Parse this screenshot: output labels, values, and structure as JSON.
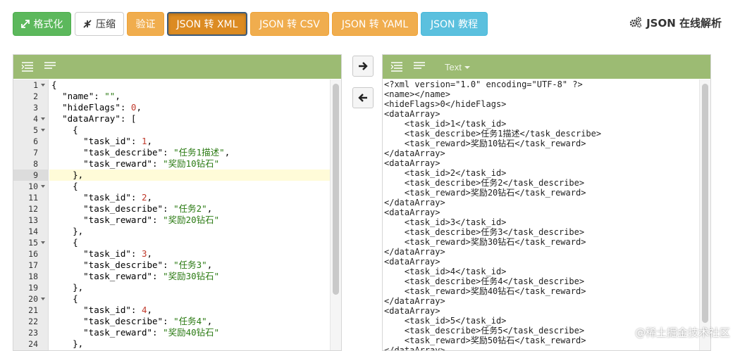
{
  "toolbar": {
    "format_label": "格式化",
    "compress_label": "压缩",
    "validate_label": "验证",
    "to_xml_label": "JSON 转 XML",
    "to_csv_label": "JSON 转 CSV",
    "to_yaml_label": "JSON 转 YAML",
    "tutorial_label": "JSON 教程",
    "brand_label": "JSON 在线解析"
  },
  "colors": {
    "green": "#5cb85c",
    "orange": "#f0ad4e",
    "orange_active": "#dc8b22",
    "info": "#5bc0de",
    "panel_header": "#9cbb73"
  },
  "right_panel": {
    "mode_label": "Text"
  },
  "editor": {
    "current_line": 9,
    "lines": [
      {
        "num": "1",
        "fold": true,
        "text": "{"
      },
      {
        "num": "2",
        "fold": false,
        "text": "  \"name\": \"\","
      },
      {
        "num": "3",
        "fold": false,
        "text": "  \"hideFlags\": 0,"
      },
      {
        "num": "4",
        "fold": true,
        "text": "  \"dataArray\": ["
      },
      {
        "num": "5",
        "fold": true,
        "text": "    {"
      },
      {
        "num": "6",
        "fold": false,
        "text": "      \"task_id\": 1,"
      },
      {
        "num": "7",
        "fold": false,
        "text": "      \"task_describe\": \"任务1描述\","
      },
      {
        "num": "8",
        "fold": false,
        "text": "      \"task_reward\": \"奖励10钻石\""
      },
      {
        "num": "9",
        "fold": false,
        "text": "    },"
      },
      {
        "num": "10",
        "fold": true,
        "text": "    {"
      },
      {
        "num": "11",
        "fold": false,
        "text": "      \"task_id\": 2,"
      },
      {
        "num": "12",
        "fold": false,
        "text": "      \"task_describe\": \"任务2\","
      },
      {
        "num": "13",
        "fold": false,
        "text": "      \"task_reward\": \"奖励20钻石\""
      },
      {
        "num": "14",
        "fold": false,
        "text": "    },"
      },
      {
        "num": "15",
        "fold": true,
        "text": "    {"
      },
      {
        "num": "16",
        "fold": false,
        "text": "      \"task_id\": 3,"
      },
      {
        "num": "17",
        "fold": false,
        "text": "      \"task_describe\": \"任务3\","
      },
      {
        "num": "18",
        "fold": false,
        "text": "      \"task_reward\": \"奖励30钻石\""
      },
      {
        "num": "19",
        "fold": false,
        "text": "    },"
      },
      {
        "num": "20",
        "fold": true,
        "text": "    {"
      },
      {
        "num": "21",
        "fold": false,
        "text": "      \"task_id\": 4,"
      },
      {
        "num": "22",
        "fold": false,
        "text": "      \"task_describe\": \"任务4\","
      },
      {
        "num": "23",
        "fold": false,
        "text": "      \"task_reward\": \"奖励40钻石\""
      },
      {
        "num": "24",
        "fold": false,
        "text": "    },"
      }
    ]
  },
  "output": {
    "lines": [
      "<?xml version=\"1.0\" encoding=\"UTF-8\" ?>",
      "<name></name>",
      "<hideFlags>0</hideFlags>",
      "<dataArray>",
      "    <task_id>1</task_id>",
      "    <task_describe>任务1描述</task_describe>",
      "    <task_reward>奖励10钻石</task_reward>",
      "</dataArray>",
      "<dataArray>",
      "    <task_id>2</task_id>",
      "    <task_describe>任务2</task_describe>",
      "    <task_reward>奖励20钻石</task_reward>",
      "</dataArray>",
      "<dataArray>",
      "    <task_id>3</task_id>",
      "    <task_describe>任务3</task_describe>",
      "    <task_reward>奖励30钻石</task_reward>",
      "</dataArray>",
      "<dataArray>",
      "    <task_id>4</task_id>",
      "    <task_describe>任务4</task_describe>",
      "    <task_reward>奖励40钻石</task_reward>",
      "</dataArray>",
      "<dataArray>",
      "    <task_id>5</task_id>",
      "    <task_describe>任务5</task_describe>",
      "    <task_reward>奖励50钻石</task_reward>",
      "</dataArray>"
    ]
  },
  "watermark": "@稀土掘金技术社区"
}
